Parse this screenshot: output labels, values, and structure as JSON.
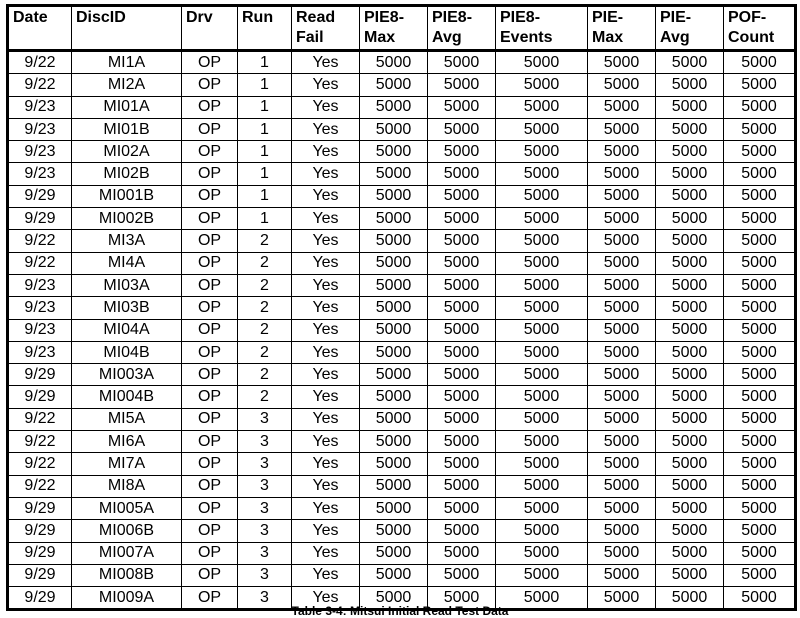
{
  "table": {
    "columns": [
      {
        "key": "date",
        "label": [
          "Date"
        ]
      },
      {
        "key": "disc_id",
        "label": [
          "DiscID"
        ]
      },
      {
        "key": "drv",
        "label": [
          "Drv"
        ]
      },
      {
        "key": "run",
        "label": [
          "Run"
        ]
      },
      {
        "key": "read_fail",
        "label": [
          "Read",
          "Fail"
        ]
      },
      {
        "key": "pie8_max",
        "label": [
          "PIE8-",
          "Max"
        ]
      },
      {
        "key": "pie8_avg",
        "label": [
          "PIE8-",
          "Avg"
        ]
      },
      {
        "key": "pie8_events",
        "label": [
          "PIE8-",
          "Events"
        ]
      },
      {
        "key": "pie_max",
        "label": [
          "PIE-",
          "Max"
        ]
      },
      {
        "key": "pie_avg",
        "label": [
          "PIE-",
          "Avg"
        ]
      },
      {
        "key": "pof_count",
        "label": [
          "POF-",
          "Count"
        ]
      }
    ],
    "rows": [
      [
        "9/22",
        "MI1A",
        "OP",
        "1",
        "Yes",
        "5000",
        "5000",
        "5000",
        "5000",
        "5000",
        "5000"
      ],
      [
        "9/22",
        "MI2A",
        "OP",
        "1",
        "Yes",
        "5000",
        "5000",
        "5000",
        "5000",
        "5000",
        "5000"
      ],
      [
        "9/23",
        "MI01A",
        "OP",
        "1",
        "Yes",
        "5000",
        "5000",
        "5000",
        "5000",
        "5000",
        "5000"
      ],
      [
        "9/23",
        "MI01B",
        "OP",
        "1",
        "Yes",
        "5000",
        "5000",
        "5000",
        "5000",
        "5000",
        "5000"
      ],
      [
        "9/23",
        "MI02A",
        "OP",
        "1",
        "Yes",
        "5000",
        "5000",
        "5000",
        "5000",
        "5000",
        "5000"
      ],
      [
        "9/23",
        "MI02B",
        "OP",
        "1",
        "Yes",
        "5000",
        "5000",
        "5000",
        "5000",
        "5000",
        "5000"
      ],
      [
        "9/29",
        "MI001B",
        "OP",
        "1",
        "Yes",
        "5000",
        "5000",
        "5000",
        "5000",
        "5000",
        "5000"
      ],
      [
        "9/29",
        "MI002B",
        "OP",
        "1",
        "Yes",
        "5000",
        "5000",
        "5000",
        "5000",
        "5000",
        "5000"
      ],
      [
        "9/22",
        "MI3A",
        "OP",
        "2",
        "Yes",
        "5000",
        "5000",
        "5000",
        "5000",
        "5000",
        "5000"
      ],
      [
        "9/22",
        "MI4A",
        "OP",
        "2",
        "Yes",
        "5000",
        "5000",
        "5000",
        "5000",
        "5000",
        "5000"
      ],
      [
        "9/23",
        "MI03A",
        "OP",
        "2",
        "Yes",
        "5000",
        "5000",
        "5000",
        "5000",
        "5000",
        "5000"
      ],
      [
        "9/23",
        "MI03B",
        "OP",
        "2",
        "Yes",
        "5000",
        "5000",
        "5000",
        "5000",
        "5000",
        "5000"
      ],
      [
        "9/23",
        "MI04A",
        "OP",
        "2",
        "Yes",
        "5000",
        "5000",
        "5000",
        "5000",
        "5000",
        "5000"
      ],
      [
        "9/23",
        "MI04B",
        "OP",
        "2",
        "Yes",
        "5000",
        "5000",
        "5000",
        "5000",
        "5000",
        "5000"
      ],
      [
        "9/29",
        "MI003A",
        "OP",
        "2",
        "Yes",
        "5000",
        "5000",
        "5000",
        "5000",
        "5000",
        "5000"
      ],
      [
        "9/29",
        "MI004B",
        "OP",
        "2",
        "Yes",
        "5000",
        "5000",
        "5000",
        "5000",
        "5000",
        "5000"
      ],
      [
        "9/22",
        "MI5A",
        "OP",
        "3",
        "Yes",
        "5000",
        "5000",
        "5000",
        "5000",
        "5000",
        "5000"
      ],
      [
        "9/22",
        "MI6A",
        "OP",
        "3",
        "Yes",
        "5000",
        "5000",
        "5000",
        "5000",
        "5000",
        "5000"
      ],
      [
        "9/22",
        "MI7A",
        "OP",
        "3",
        "Yes",
        "5000",
        "5000",
        "5000",
        "5000",
        "5000",
        "5000"
      ],
      [
        "9/22",
        "MI8A",
        "OP",
        "3",
        "Yes",
        "5000",
        "5000",
        "5000",
        "5000",
        "5000",
        "5000"
      ],
      [
        "9/29",
        "MI005A",
        "OP",
        "3",
        "Yes",
        "5000",
        "5000",
        "5000",
        "5000",
        "5000",
        "5000"
      ],
      [
        "9/29",
        "MI006B",
        "OP",
        "3",
        "Yes",
        "5000",
        "5000",
        "5000",
        "5000",
        "5000",
        "5000"
      ],
      [
        "9/29",
        "MI007A",
        "OP",
        "3",
        "Yes",
        "5000",
        "5000",
        "5000",
        "5000",
        "5000",
        "5000"
      ],
      [
        "9/29",
        "MI008B",
        "OP",
        "3",
        "Yes",
        "5000",
        "5000",
        "5000",
        "5000",
        "5000",
        "5000"
      ],
      [
        "9/29",
        "MI009A",
        "OP",
        "3",
        "Yes",
        "5000",
        "5000",
        "5000",
        "5000",
        "5000",
        "5000"
      ]
    ]
  },
  "caption": "Table 3-4: Mitsui Initial Read Test Data"
}
